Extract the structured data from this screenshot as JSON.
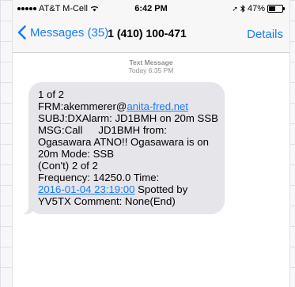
{
  "status_bar": {
    "carrier": "AT&T M-Cell",
    "time": "6:42 PM",
    "battery_percent": "47%",
    "battery_level": 0.47,
    "icons": [
      "signal-dots-icon",
      "wifi-icon",
      "location-arrow-icon",
      "bluetooth-icon",
      "battery-icon"
    ]
  },
  "nav": {
    "back_label": "Messages (35)",
    "title": "1 (410) 100-471",
    "details_label": "Details"
  },
  "thread": {
    "timestamp_label": "Text Message",
    "timestamp_time": "Today 6:35 PM",
    "message": {
      "line1": "1 of 2",
      "line2_prefix": "FRM:akemmerer@",
      "line2_link": "anita-fred.net",
      "line3": "SUBJ:DXAlarm: JD1BMH on 20m SSB",
      "line4_a": "MSG:Call",
      "line4_b": "JD1BMH from:",
      "line5": "Ogasawara ATNO!! Ogasawara is on",
      "line6": "20m Mode: SSB",
      "line7": "(Con't) 2 of 2",
      "line8": "Frequency: 14250.0 Time:",
      "line9_link": "2016-01-04 23:19:00",
      "line9_suffix": " Spotted by",
      "line10": "YV5TX Comment: None(End)"
    }
  },
  "colors": {
    "accent": "#1a7cf5",
    "bubble": "#e5e5ea",
    "timestamp": "#8e8e93"
  }
}
